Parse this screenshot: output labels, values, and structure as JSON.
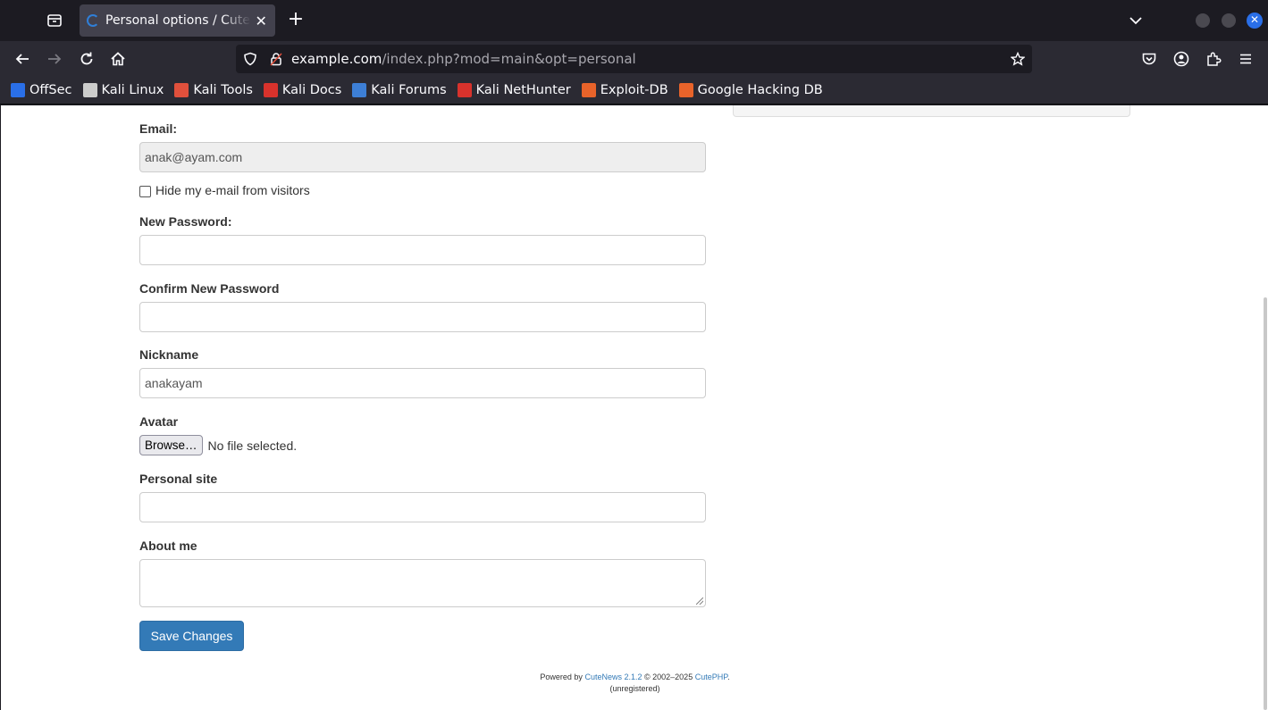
{
  "browser": {
    "tab": {
      "title": "Personal options / CuteNews"
    },
    "url": {
      "domain": "example.com",
      "path": "/index.php?mod=main&opt=personal"
    },
    "bookmarks": [
      {
        "label": "OffSec",
        "icon": "offsec-icon",
        "color": "#2a6fe8"
      },
      {
        "label": "Kali Linux",
        "icon": "kali-dragon-icon",
        "color": "#cccccc"
      },
      {
        "label": "Kali Tools",
        "icon": "kali-tools-icon",
        "color": "#e0503c"
      },
      {
        "label": "Kali Docs",
        "icon": "kali-docs-icon",
        "color": "#d8322c"
      },
      {
        "label": "Kali Forums",
        "icon": "kali-forums-icon",
        "color": "#3d7fd6"
      },
      {
        "label": "Kali NetHunter",
        "icon": "nethunter-icon",
        "color": "#d8322c"
      },
      {
        "label": "Exploit-DB",
        "icon": "exploit-db-icon",
        "color": "#e8632a"
      },
      {
        "label": "Google Hacking DB",
        "icon": "ghdb-icon",
        "color": "#e8632a"
      }
    ]
  },
  "form": {
    "email_label": "Email:",
    "email_value": "anak@ayam.com",
    "hide_email_label": "Hide my e-mail from visitors",
    "hide_email_checked": false,
    "new_password_label": "New Password:",
    "confirm_password_label": "Confirm New Password",
    "nickname_label": "Nickname",
    "nickname_value": "anakayam",
    "avatar_label": "Avatar",
    "browse_label": "Browse…",
    "no_file_text": "No file selected.",
    "site_label": "Personal site",
    "about_label": "About me",
    "save_label": "Save Changes"
  },
  "footer": {
    "powered_by": "Powered by",
    "product": "CuteNews 2.1.2",
    "copyright": "© 2002–2025",
    "vendor": "CutePHP",
    "period": ".",
    "status": "(unregistered)"
  },
  "colors": {
    "accent": "#337ab7",
    "link": "#337ab7",
    "browser_dark": "#1c1b22"
  }
}
